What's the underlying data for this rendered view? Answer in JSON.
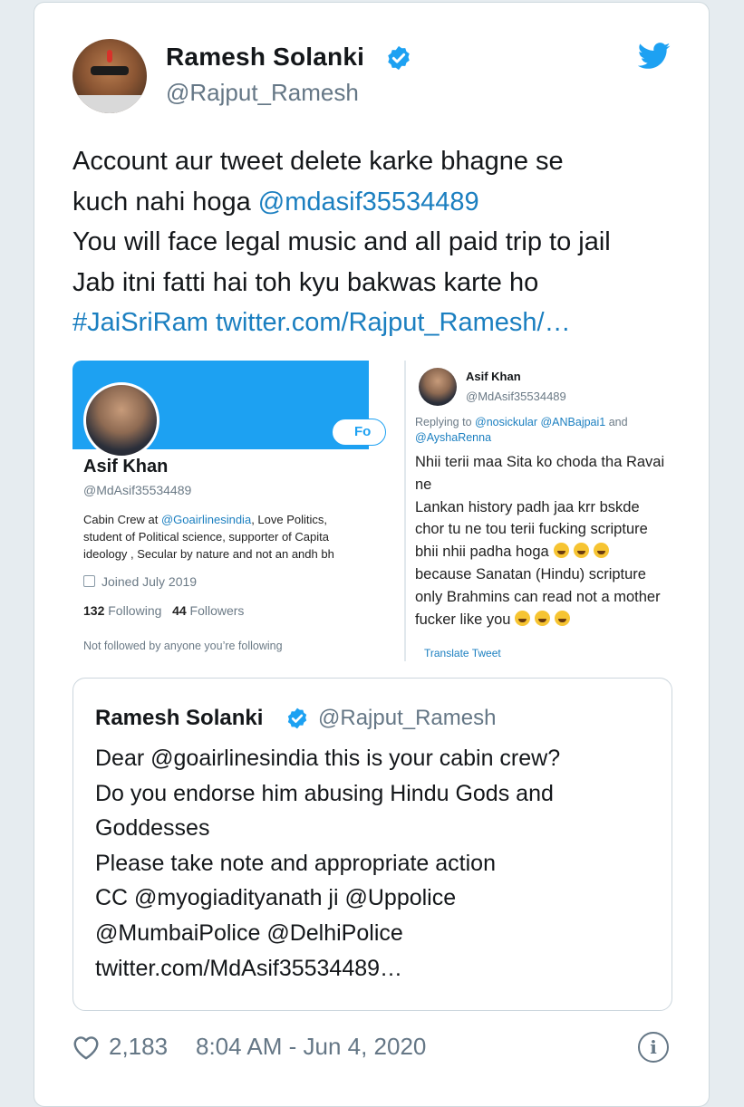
{
  "author": {
    "name": "Ramesh Solanki",
    "handle": "@Rajput_Ramesh",
    "verified_icon": "verified-badge-icon",
    "brand_color": "#1da1f2"
  },
  "tweet": {
    "lines": [
      {
        "pre": "Account aur tweet delete karke bhagne se",
        "link": ""
      },
      {
        "pre": "kuch nahi hoga ",
        "link": "@mdasif35534489"
      },
      {
        "pre": "You will face legal music and all paid trip to jail",
        "link": ""
      },
      {
        "pre": "Jab itni fatti hai toh kyu bakwas karte ho",
        "link": ""
      }
    ],
    "hashtag": "#JaiSriRam",
    "url": "twitter.com/Rajput_Ramesh/…"
  },
  "media": {
    "profile": {
      "name": "Asif Khan",
      "handle": "@MdAsif35534489",
      "follow_button": "Fo",
      "bio_lines": [
        {
          "pre": "Cabin Crew at ",
          "link": "@Goairlinesindia",
          "post": ",  Love Politics,"
        },
        {
          "pre": "student of Political science, supporter of Capita",
          "link": "",
          "post": ""
        },
        {
          "pre": "ideology , Secular by nature and not an andh bh",
          "link": "",
          "post": ""
        }
      ],
      "joined": "Joined July 2019",
      "following_count": "132",
      "following_label": "Following",
      "followers_count": "44",
      "followers_label": "Followers",
      "not_followed": "Not followed by anyone you’re following"
    },
    "reply": {
      "name": "Asif Khan",
      "handle": "@MdAsif35534489",
      "replying_prefix": "Replying to",
      "replying_to": [
        "@nosickular",
        "@ANBajpai1",
        "@AyshaRenna"
      ],
      "replying_joiner": "and",
      "text_lines": [
        "Nhii terii maa Sita ko choda tha Ravai",
        "ne",
        "Lankan history padh jaa krr bskde",
        "chor tu ne tou terii fucking scripture",
        "bhii nhii padha hoga",
        "because Sanatan (Hindu) scripture",
        "only Brahmins can read not a mother",
        "fucker like you"
      ],
      "emoji_icon": "laughing-face-emoji",
      "translate": "Translate Tweet"
    }
  },
  "quoted": {
    "name": "Ramesh Solanki",
    "handle": "@Rajput_Ramesh",
    "lines": [
      "Dear @goairlinesindia this is your cabin crew?",
      "Do you endorse him abusing Hindu Gods and",
      "Goddesses",
      "Please take note and appropriate action",
      "CC @myogiadityanath ji @Uppolice",
      "@MumbaiPolice @DelhiPolice",
      "twitter.com/MdAsif35534489…"
    ]
  },
  "footer": {
    "likes": "2,183",
    "timestamp": "8:04 AM - Jun 4, 2020",
    "like_icon": "heart-icon",
    "info_icon": "info-icon",
    "info_glyph": "i"
  }
}
